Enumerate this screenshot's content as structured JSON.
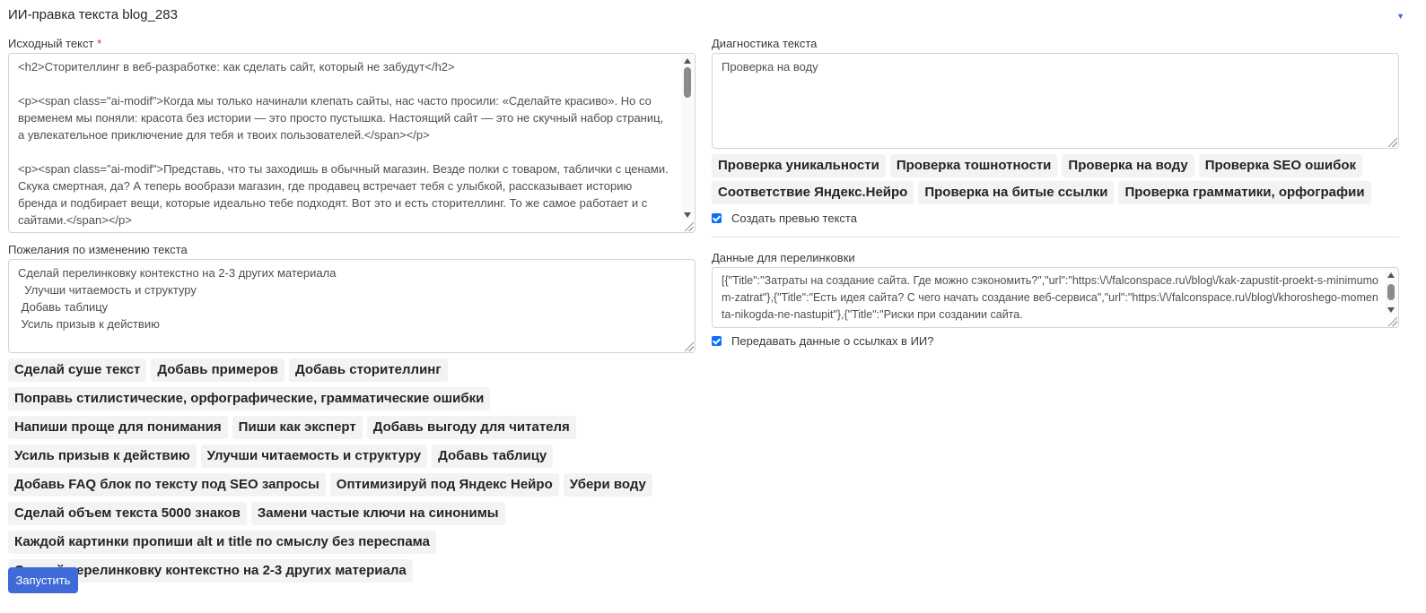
{
  "header": {
    "title": "ИИ-правка текста blog_283"
  },
  "source": {
    "label": "Исходный текст",
    "required_mark": "*",
    "text": "<h2>Сторителлинг в веб-разработке: как сделать сайт, который не забудут</h2>\n\n<p><span class=\"ai-modif\">Когда мы только начинали клепать сайты, нас часто просили: «Сделайте красиво». Но со временем мы поняли: красота без истории — это просто пустышка. Настоящий сайт — это не скучный набор страниц, а увлекательное приключение для тебя и твоих пользователей.</span></p>\n\n<p><span class=\"ai-modif\">Представь, что ты заходишь в обычный магазин. Везде полки с товаром, таблички с ценами. Скука смертная, да? А теперь вообрази магазин, где продавец встречает тебя с улыбкой, рассказывает историю бренда и подбирает вещи, которые идеально тебе подходят. Вот это и есть сторителлинг. То же самое работает и с сайтами.</span></p>",
    "scroll_position": 0.05
  },
  "wishes": {
    "label": "Пожелания по изменению текста",
    "text": "Сделай перелинковку контекстно на 2-3 других материала\n  Улучши читаемость и структуру\n Добавь таблицу\n Усиль призыв к действию"
  },
  "wish_chips": [
    "Сделай суше текст",
    "Добавь примеров",
    "Добавь сторителлинг",
    "Поправь стилистические, орфографические, грамматические ошибки",
    "Напиши проще для понимания",
    "Пиши как эксперт",
    "Добавь выгоду для читателя",
    "Усиль призыв к действию",
    "Улучши читаемость и структуру",
    "Добавь таблицу",
    "Добавь FAQ блок по тексту под SEO запросы",
    "Оптимизируй под Яндекс Нейро",
    "Убери воду",
    "Сделай объем текста 5000 знаков",
    "Замени частые ключи на синонимы",
    "Каждой картинки пропиши alt и title по смыслу без переспама",
    "Сделай перелинковку контекстно на 2-3 других материала"
  ],
  "diagnostics": {
    "label": "Диагностика текста",
    "text": "Проверка на воду"
  },
  "diag_chips": [
    "Проверка уникальности",
    "Проверка тошнотности",
    "Проверка на воду",
    "Проверка SEO ошибок",
    "Соответствие Яндекс.Нейро",
    "Проверка на битые ссылки",
    "Проверка грамматики, орфографии"
  ],
  "preview_checkbox": {
    "label": "Создать превью текста",
    "checked": true
  },
  "links": {
    "label": "Данные для перелинковки",
    "text": "[{\"Title\":\"Затраты на создание сайта. Где можно сэкономить?\",\"url\":\"https:\\/\\/falconspace.ru\\/blog\\/kak-zapustit-proekt-s-minimumom-zatrat\"},{\"Title\":\"Есть идея сайта? С чего начать создание веб-сервиса\",\"url\":\"https:\\/\\/falconspace.ru\\/blog\\/khoroshego-momenta-nikogda-ne-nastupit\"},{\"Title\":\"Риски при создании сайта."
  },
  "links_checkbox": {
    "label": "Передавать данные о ссылках в ИИ?",
    "checked": true
  },
  "run_button": {
    "label": "Запустить"
  },
  "colors": {
    "primary": "#3f6ad8",
    "checkbox": "#0d6efd",
    "required": "#d92550",
    "chip_bg": "#f3f3f3"
  }
}
